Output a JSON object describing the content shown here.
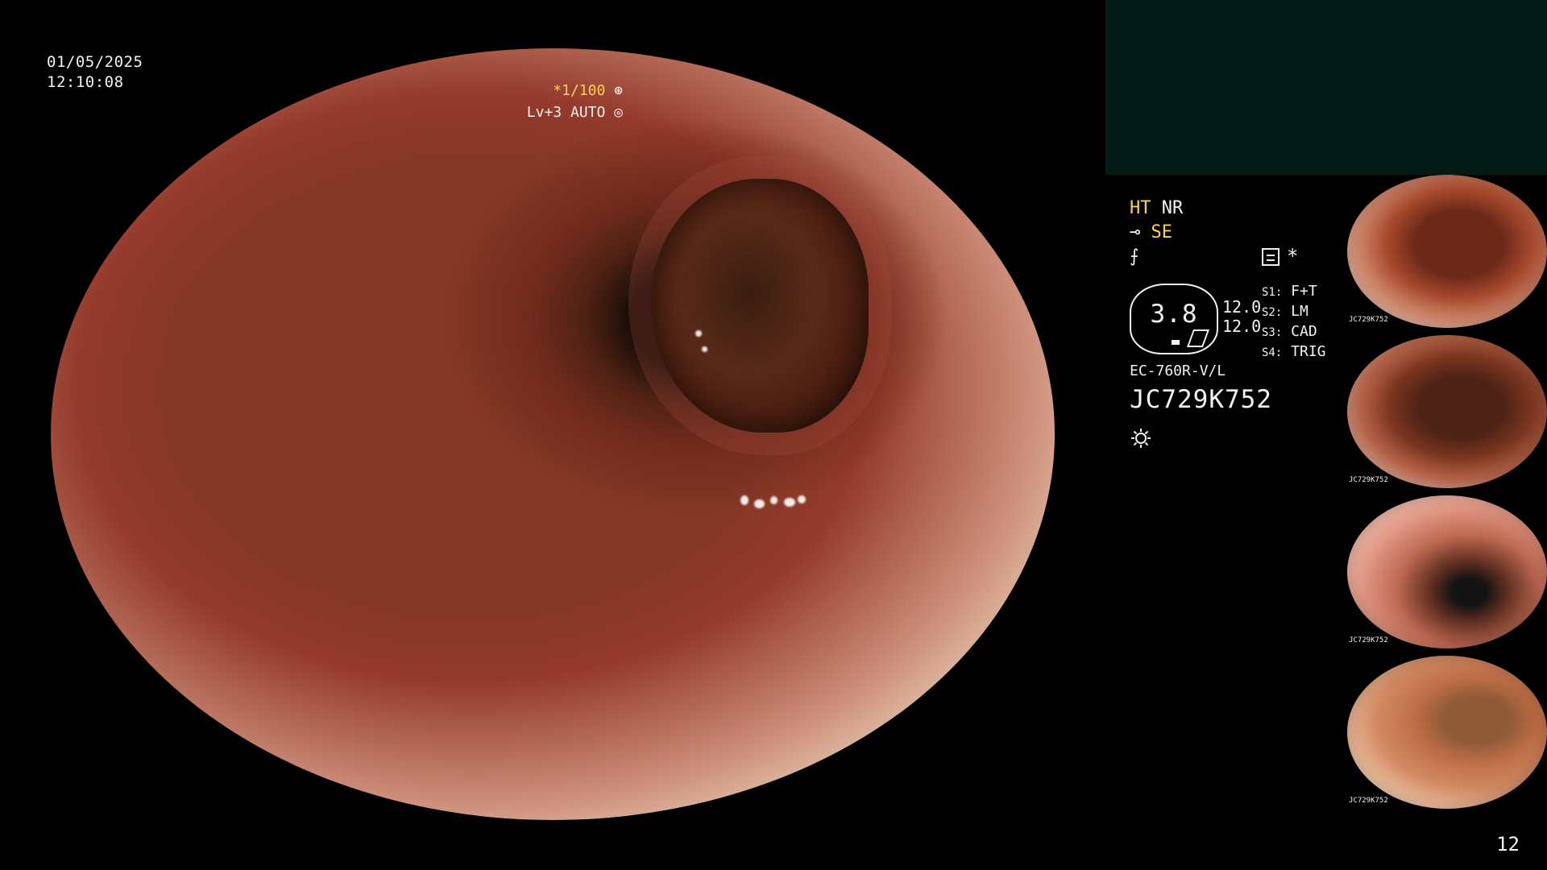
{
  "overlay": {
    "date": "01/05/2025",
    "time": "12:10:08",
    "exposure": "*1/100",
    "level_auto": "Lv+3 AUTO"
  },
  "right_panel": {
    "mode_ht": "HT",
    "mode_nr": "NR",
    "mode_se": "SE",
    "gauge_value": "3.8",
    "gauge_reading_top": "12.0",
    "gauge_reading_bottom": "12.0",
    "settings": [
      {
        "label": "S1:",
        "value": "F+T"
      },
      {
        "label": "S2:",
        "value": "LM"
      },
      {
        "label": "S3:",
        "value": "CAD"
      },
      {
        "label": "S4:",
        "value": "TRIG"
      }
    ],
    "scope_model": "EC-760R-V/L",
    "scope_id": "JC729K752"
  },
  "thumbnails": [
    {
      "id": "JC729K752"
    },
    {
      "id": "JC729K752"
    },
    {
      "id": "JC729K752"
    },
    {
      "id": "JC729K752"
    }
  ],
  "page_number": "12",
  "colors": {
    "accent_yellow": "#ffd24d",
    "panel_bg": "#041a15",
    "text": "#f2f2f2"
  },
  "icons": {
    "exposure": "shutter-icon",
    "auto": "aperture-icon",
    "menu": "menu-icon",
    "light": "sun-icon"
  }
}
